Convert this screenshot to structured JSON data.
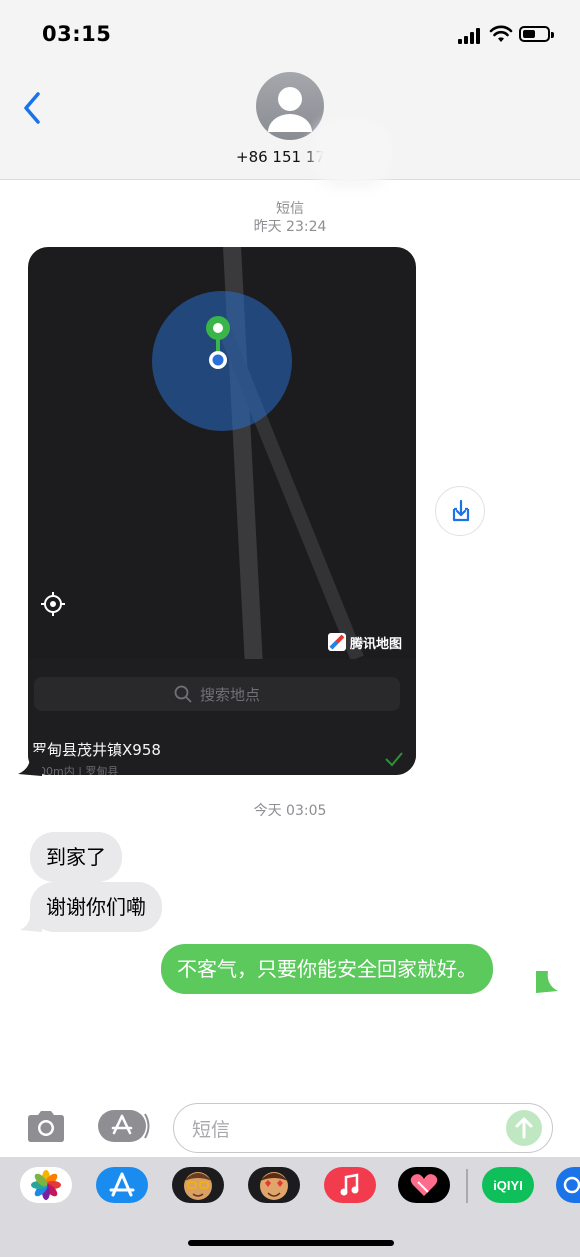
{
  "status_bar": {
    "time": "03:15"
  },
  "header": {
    "contact_number": "+86 151 1788"
  },
  "timestamps": {
    "first_label": "短信",
    "first_time": "昨天 23:24",
    "second_time": "今天 03:05"
  },
  "map_card": {
    "provider_label": "腾讯地图",
    "search_placeholder": "搜索地点",
    "location_title": "罗甸县茂井镇X958",
    "location_subtitle": "100m内 | 罗甸县"
  },
  "messages": [
    {
      "direction": "incoming",
      "text": "到家了"
    },
    {
      "direction": "incoming",
      "text": "谢谢你们嘞"
    },
    {
      "direction": "outgoing",
      "text": "不客气，只要你能安全回家就好。"
    }
  ],
  "composer": {
    "placeholder": "短信"
  },
  "app_drawer": {
    "apps": [
      "photos-app",
      "app-store-app",
      "memoji-app",
      "memoji-stickers-app",
      "music-app",
      "heart-app",
      "iqiyi-app",
      "more-app"
    ],
    "iqiyi_label": "iQIYI"
  },
  "colors": {
    "accent_blue": "#1a73e8",
    "outgoing_bubble": "#5bc95c",
    "incoming_bubble": "#e9e9eb",
    "pin_green": "#39b54a"
  }
}
